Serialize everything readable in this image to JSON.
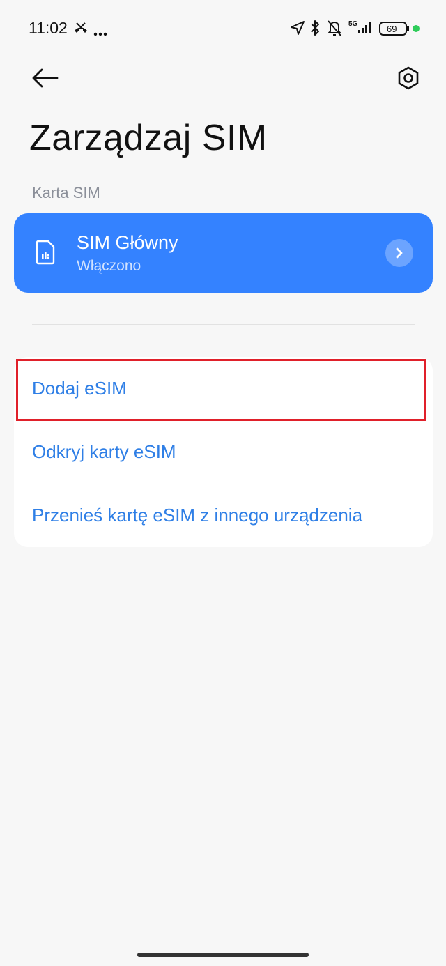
{
  "status_bar": {
    "time": "11:02",
    "icons": [
      "missed-call-icon",
      "more-dots-icon",
      "location-icon",
      "bluetooth-icon",
      "mute-bell-icon",
      "signal-5g-icon",
      "battery-icon"
    ],
    "network": "5G",
    "battery": "69",
    "dot_color": "#2ecc5a"
  },
  "header": {
    "title": "Zarządzaj SIM"
  },
  "sim_section": {
    "label": "Karta SIM",
    "card": {
      "name": "SIM Główny",
      "status": "Włączono",
      "color": "#3482ff"
    }
  },
  "esim_options": [
    {
      "label": "Dodaj eSIM"
    },
    {
      "label": "Odkryj karty eSIM"
    },
    {
      "label": "Przenieś kartę eSIM z innego urządzenia"
    }
  ],
  "colors": {
    "accent": "#2f7fe6",
    "highlight": "#e0202a",
    "background": "#f7f7f7"
  }
}
